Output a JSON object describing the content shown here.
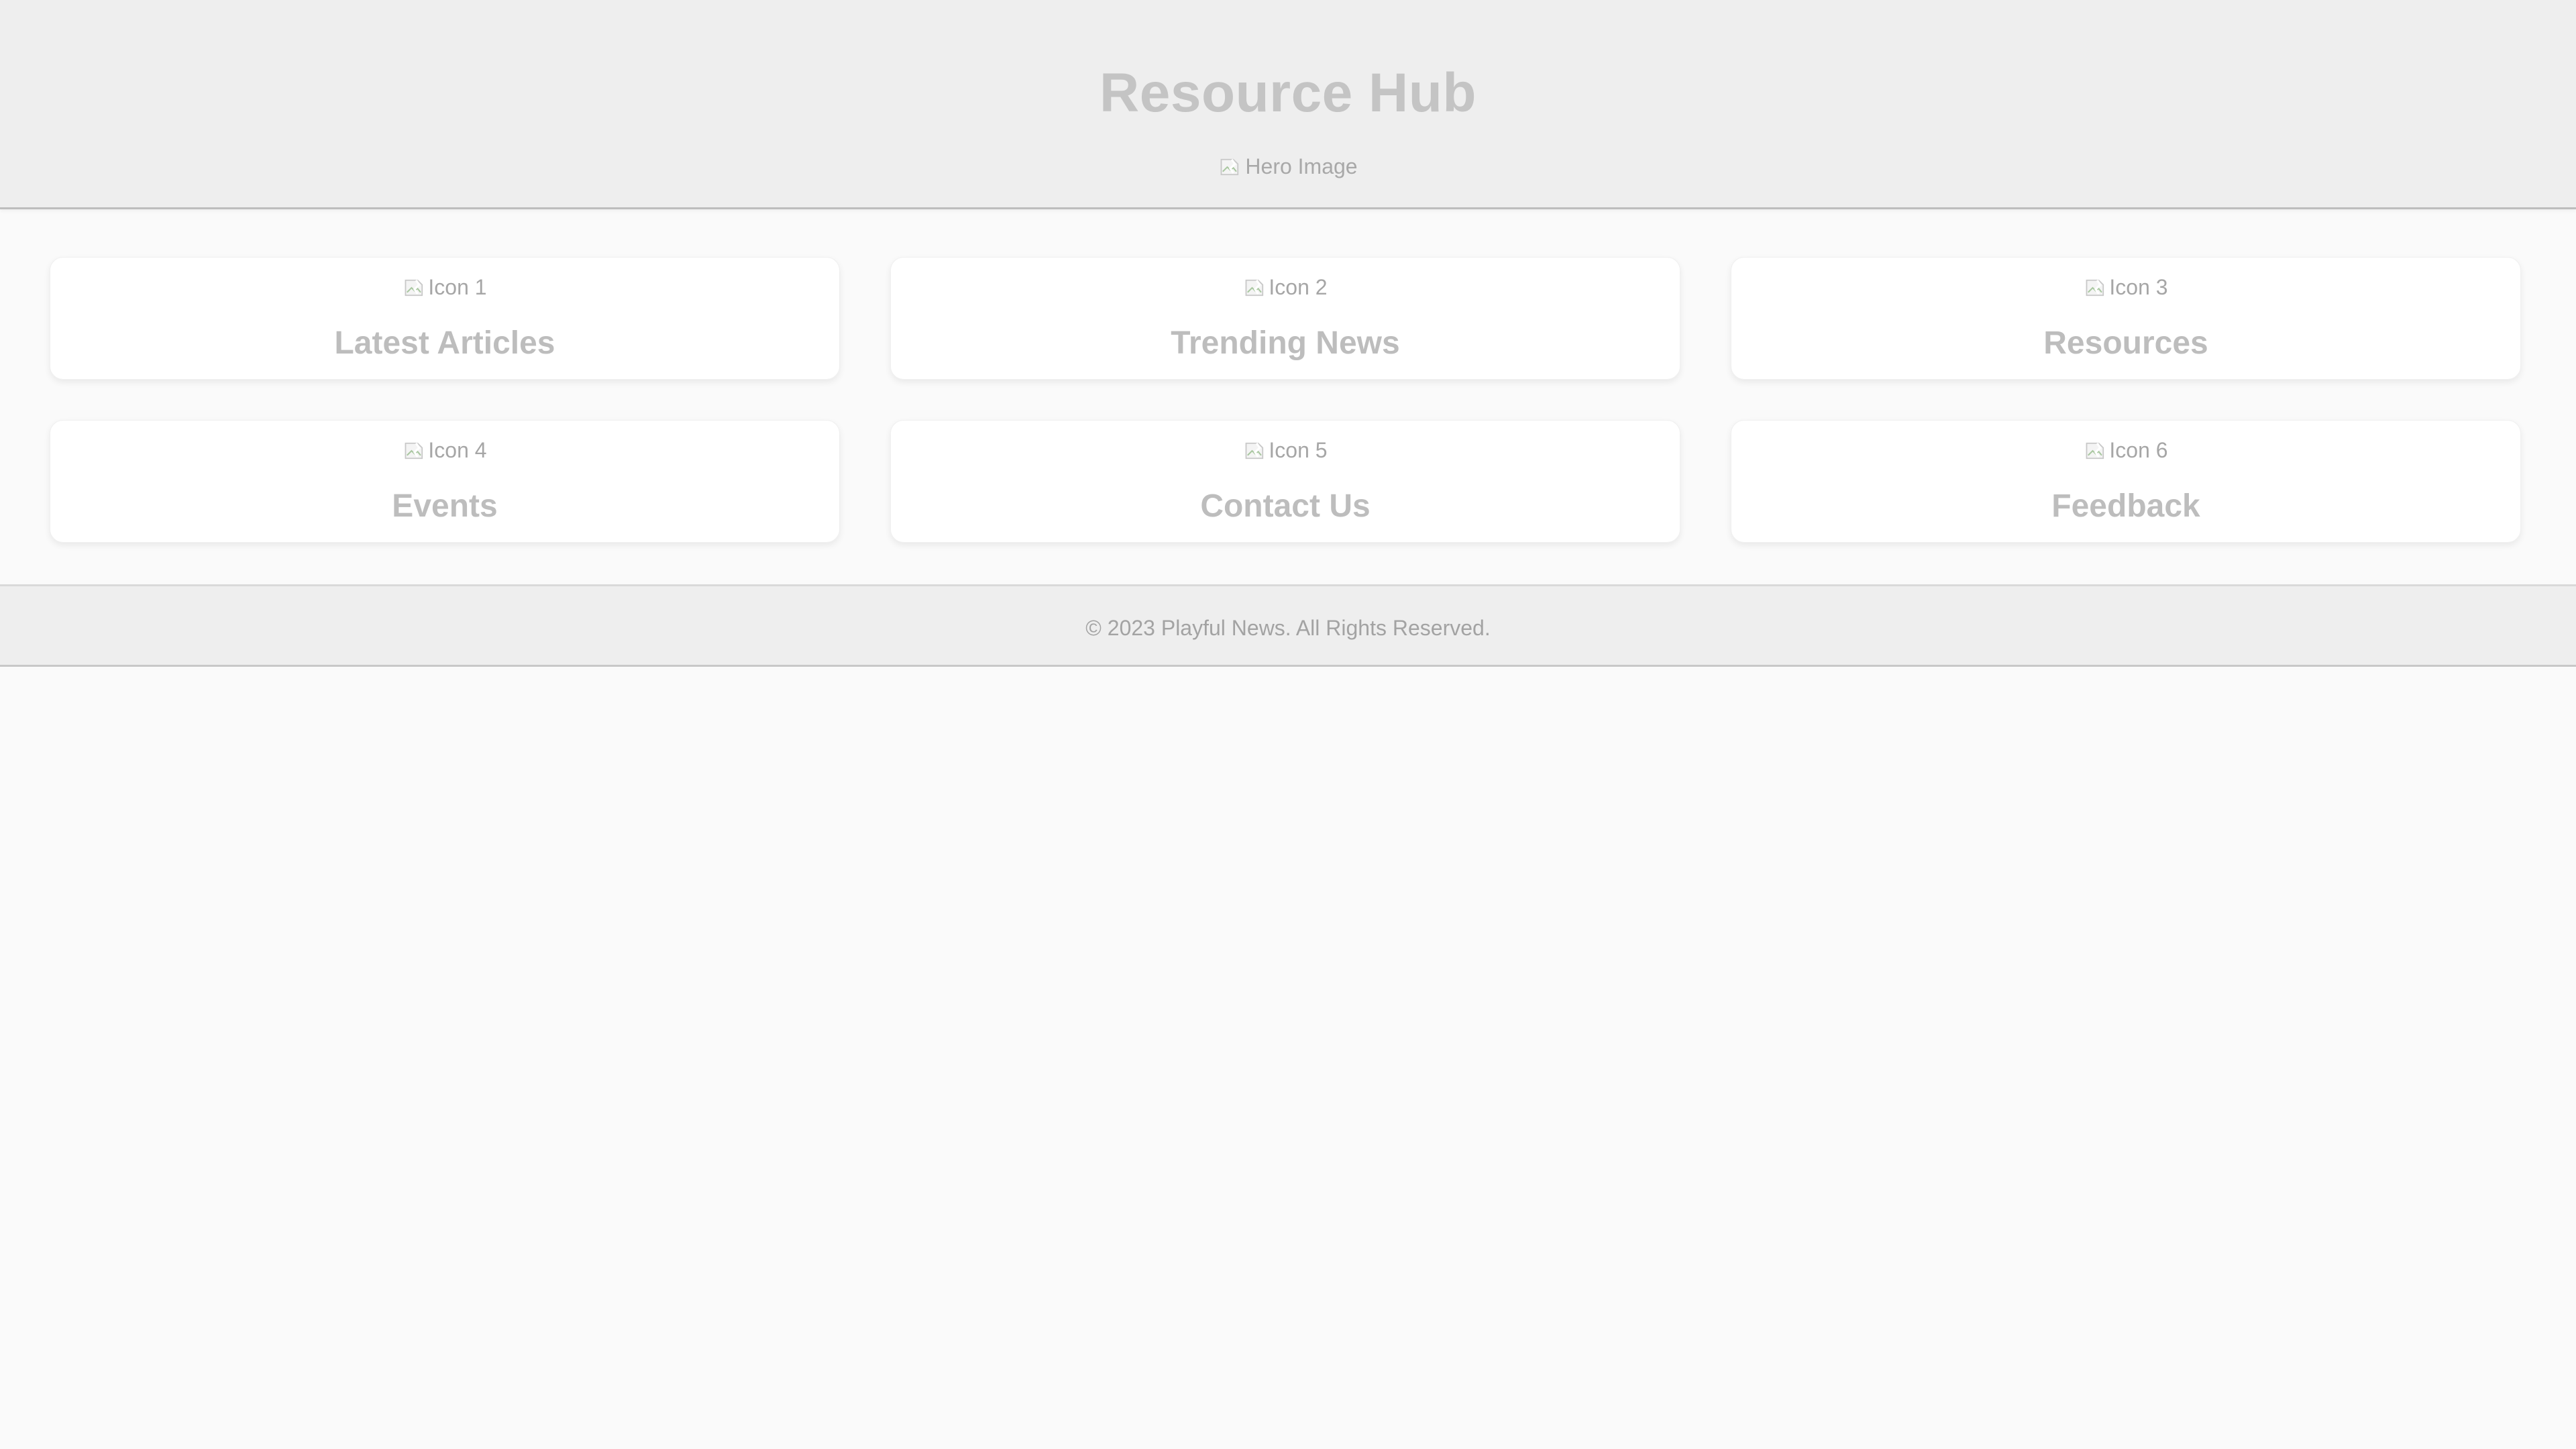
{
  "header": {
    "title": "Resource Hub",
    "hero_alt": "Hero Image"
  },
  "cards": [
    {
      "icon_alt": "Icon 1",
      "title": "Latest Articles"
    },
    {
      "icon_alt": "Icon 2",
      "title": "Trending News"
    },
    {
      "icon_alt": "Icon 3",
      "title": "Resources"
    },
    {
      "icon_alt": "Icon 4",
      "title": "Events"
    },
    {
      "icon_alt": "Icon 5",
      "title": "Contact Us"
    },
    {
      "icon_alt": "Icon 6",
      "title": "Feedback"
    }
  ],
  "footer": {
    "text": "© 2023 Playful News. All Rights Reserved."
  },
  "icons": {
    "broken_image": "broken-image-icon"
  },
  "colors": {
    "page_background": "#fafafa",
    "header_background": "#eeeeee",
    "card_background": "#ffffff",
    "title_text": "#c4c4c4"
  }
}
